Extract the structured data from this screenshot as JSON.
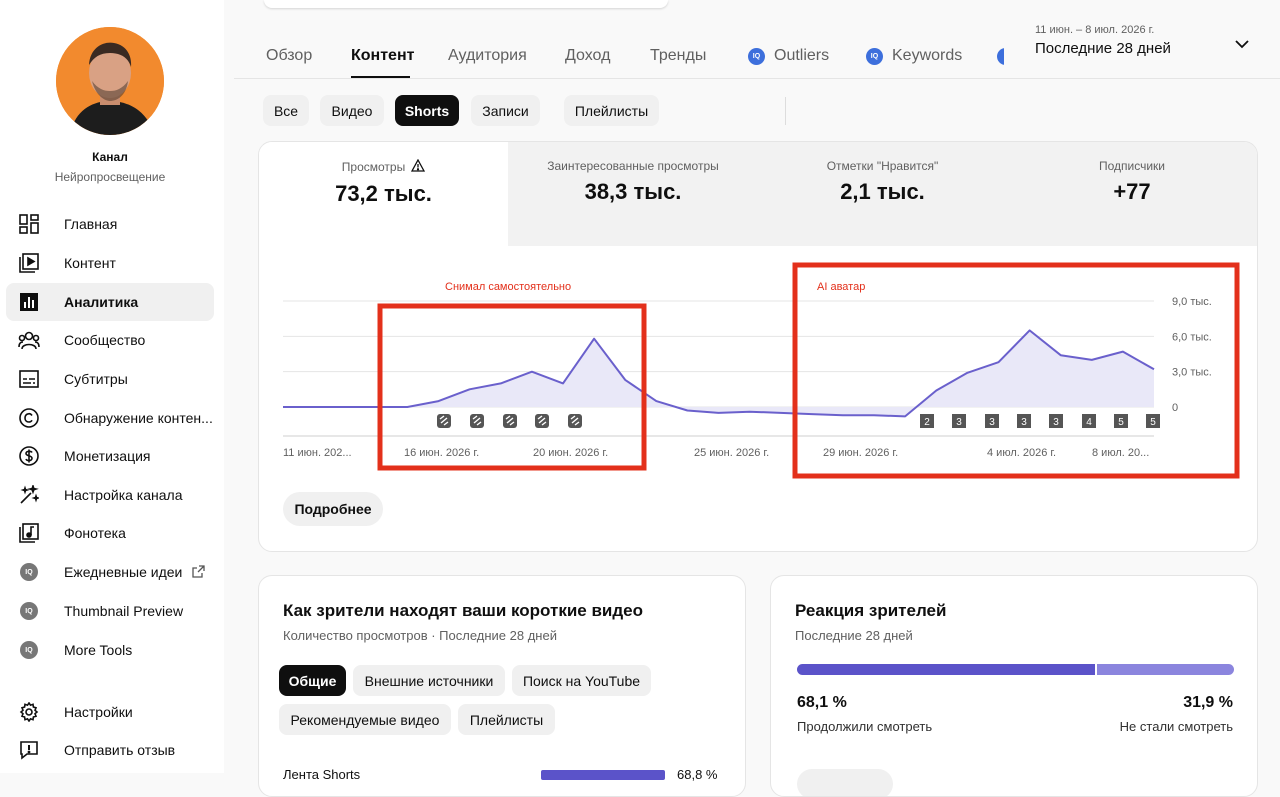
{
  "sidebar": {
    "channel_title": "Канал",
    "channel_name": "Нейропросвещение",
    "items": [
      {
        "label": "Главная"
      },
      {
        "label": "Контент"
      },
      {
        "label": "Аналитика"
      },
      {
        "label": "Сообщество"
      },
      {
        "label": "Субтитры"
      },
      {
        "label": "Обнаружение контен..."
      },
      {
        "label": "Монетизация"
      },
      {
        "label": "Настройка канала"
      },
      {
        "label": "Фонотека"
      },
      {
        "label": "Ежедневные идеи"
      },
      {
        "label": "Thumbnail Preview"
      },
      {
        "label": "More Tools"
      }
    ],
    "bottom_items": [
      {
        "label": "Настройки"
      },
      {
        "label": "Отправить отзыв"
      }
    ]
  },
  "tabs": {
    "items": [
      {
        "label": "Обзор"
      },
      {
        "label": "Контент"
      },
      {
        "label": "Аудитория"
      },
      {
        "label": "Доход"
      },
      {
        "label": "Тренды"
      },
      {
        "label": "Outliers"
      },
      {
        "label": "Keywords"
      }
    ],
    "iq_badge": "IQ",
    "active": "Контент"
  },
  "date_range": {
    "range": "11 июн. – 8 июл. 2026 г.",
    "label": "Последние 28 дней"
  },
  "filters": {
    "chips": [
      {
        "label": "Все"
      },
      {
        "label": "Видео"
      },
      {
        "label": "Shorts"
      },
      {
        "label": "Записи"
      },
      {
        "label": "Плейлисты"
      }
    ],
    "active": "Shorts"
  },
  "metrics": [
    {
      "label": "Просмотры",
      "value": "73,2 тыс."
    },
    {
      "label": "Заинтересованные просмотры",
      "value": "38,3 тыс."
    },
    {
      "label": "Отметки \"Нравится\"",
      "value": "2,1 тыс."
    },
    {
      "label": "Подписчики",
      "value": "+77"
    }
  ],
  "chart_data": {
    "type": "area",
    "x": [
      "11 июн.",
      "12 июн.",
      "13 июн.",
      "14 июн.",
      "15 июн.",
      "16 июн.",
      "17 июн.",
      "18 июн.",
      "19 июн.",
      "20 июн.",
      "21 июн.",
      "22 июн.",
      "23 июн.",
      "24 июн.",
      "25 июн.",
      "26 июн.",
      "27 июн.",
      "28 июн.",
      "29 июн.",
      "30 июн.",
      "1 июл.",
      "2 июл.",
      "3 июл.",
      "4 июл.",
      "5 июл.",
      "6 июл.",
      "7 июл.",
      "8 июл."
    ],
    "series": [
      {
        "values": [
          0,
          0,
          0,
          0,
          0,
          500,
          1500,
          2000,
          3000,
          2000,
          5800,
          2300,
          500,
          -300,
          -500,
          -400,
          -500,
          -600,
          -700,
          -700,
          -800,
          1400,
          2900,
          3800,
          6500,
          4400,
          4000,
          4700,
          3200
        ]
      }
    ],
    "xtick_labels": [
      "11 июн. 202...",
      "16 июн. 2026 г.",
      "20 июн. 2026 г.",
      "25 июн. 2026 г.",
      "29 июн. 2026 г.",
      "4 июл. 2026 г.",
      "8 июл. 20..."
    ],
    "ytick_labels": [
      "9,0 тыс.",
      "6,0 тыс.",
      "3,0 тыс.",
      "0"
    ],
    "ylim": [
      0,
      9000
    ],
    "grid": true,
    "markers": [
      "2",
      "3",
      "3",
      "3",
      "3",
      "4",
      "5",
      "5"
    ],
    "annotations": [
      "Снимал самостоятельно",
      "AI аватар"
    ]
  },
  "chart_card": {
    "more_button": "Подробнее"
  },
  "discovery_card": {
    "title": "Как зрители находят ваши короткие видео",
    "subtitle": "Количество просмотров · Последние 28 дней",
    "pills": [
      {
        "label": "Общие"
      },
      {
        "label": "Внешние источники"
      },
      {
        "label": "Поиск на YouTube"
      },
      {
        "label": "Рекомендуемые видео"
      },
      {
        "label": "Плейлисты"
      }
    ],
    "row_label": "Лента Shorts",
    "row_value": "68,8 %"
  },
  "reaction_card": {
    "title": "Реакция зрителей",
    "subtitle": "Последние 28 дней",
    "continued_pct": "68,1 %",
    "continued_label": "Продолжили смотреть",
    "continued_fraction": 0.681,
    "stopped_pct": "31,9 %",
    "stopped_label": "Не стали смотреть",
    "colors": {
      "continued": "#5b53c9",
      "stopped": "#8b85de"
    }
  }
}
